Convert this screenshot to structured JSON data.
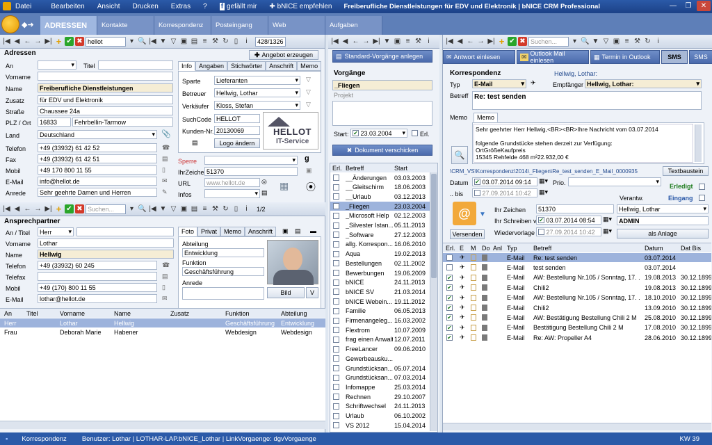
{
  "menu": {
    "items": [
      "Datei",
      "Bearbeiten",
      "Ansicht",
      "Drucken",
      "Extras",
      "?"
    ],
    "like": "gefällt mir",
    "bnice": "bNICE empfehlen",
    "title": "Freiberufliche Dienstleistungen für EDV und Elektronik | bNICE CRM  Professional"
  },
  "tabs": [
    "ADRESSEN",
    "Kontakte",
    "Korrespondenz",
    "Posteingang",
    "Web",
    "Aufgaben"
  ],
  "left_toolbar": {
    "search": "hellot",
    "count": "428/1326"
  },
  "address": {
    "section": "Adressen",
    "angebot_btn": "Angebot erzeugen",
    "labels": {
      "an": "An",
      "titel": "Titel",
      "vorname": "Vorname",
      "name": "Name",
      "zusatz": "Zusatz",
      "strasse": "Straße",
      "plz": "PLZ / Ort",
      "land": "Land",
      "telefon": "Telefon",
      "fax": "Fax",
      "mobil": "Mobil",
      "email": "E-Mail",
      "anrede": "Anrede"
    },
    "name": "Freiberufliche Dienstleistungen",
    "zusatz": "für EDV und Elektronik",
    "strasse": "Chaussee 24a",
    "plz": "16833",
    "ort": "Fehrbellin-Tarmow",
    "land": "Deutschland",
    "telefon": "+49 (33932)  61 42 52",
    "fax": "+49 (33932) 61 42 51",
    "mobil": "+49 170 800 11 55",
    "email": "info@hellot.de",
    "anrede": "Sehr geehrte Damen und Herren"
  },
  "info_tabs": [
    "Info",
    "Angaben",
    "Stichwörter",
    "Anschrift",
    "Memo"
  ],
  "info": {
    "sparte_l": "Sparte",
    "sparte": "Lieferanten",
    "betreuer_l": "Betreuer",
    "betreuer": "Hellwig, Lothar",
    "verkaeufer_l": "Verkäufer",
    "verkaeufer": "Kloss, Stefan",
    "suchcode_l": "SuchCode",
    "suchcode": "HELLOT",
    "kunden_l": "Kunden-Nr.",
    "kunden": "20130069",
    "logo_btn": "Logo ändern",
    "logo_line1": "HELLOT",
    "logo_line2": "IT-Service",
    "sperre_l": "Sperre",
    "ihrzeichen_l": "IhrZeichen",
    "ihrzeichen": "51370",
    "url_l": "URL",
    "url_ph": "www.hellot.de",
    "infos_l": "Infos"
  },
  "ap_toolbar": {
    "search": "Suchen...",
    "count": "1/2"
  },
  "ansprechpartner": {
    "section": "Ansprechpartner",
    "labels": {
      "an": "An / Titel",
      "vorname": "Vorname",
      "name": "Name",
      "telefon": "Telefon",
      "telefax": "Telefax",
      "mobil": "Mobil",
      "email": "E-Mail"
    },
    "an": "Herr",
    "vorname": "Lothar",
    "name": "Hellwig",
    "telefon": "+49 (33932) 60 245",
    "mobil": "+49 (170) 800 11 55",
    "email": "lothar@hellot.de"
  },
  "foto_tabs": [
    "Foto",
    "Privat",
    "Memo",
    "Anschrift"
  ],
  "foto": {
    "abteilung_l": "Abteilung",
    "abteilung": "Entwicklung",
    "funktion_l": "Funktion",
    "funktion": "Geschäftsführung",
    "anrede_l": "Anrede",
    "bild_btn": "Bild",
    "v_btn": "V"
  },
  "ap_table": {
    "headers": [
      "An",
      "Titel",
      "Vorname",
      "Name",
      "Zusatz",
      "Funktion",
      "Abteilung"
    ],
    "rows": [
      [
        "Herr",
        "",
        "Lothar",
        "Hellwig",
        "",
        "Geschäftsführung",
        "Entwicklung"
      ],
      [
        "Frau",
        "",
        "Deborah Marie",
        "Habener",
        "",
        "Webdesign",
        "Webdesign"
      ]
    ]
  },
  "vorgaenge": {
    "btn": "Standard-Vorgänge anlegen",
    "section": "Vorgänge",
    "current": "_Fliegen",
    "projekt_l": "Projekt",
    "start_l": "Start:",
    "start": "23.03.2004",
    "erl": "Erl.",
    "doc_btn": "Dokument verschicken",
    "headers": [
      "Erl.",
      "Betreff",
      "Start"
    ],
    "rows": [
      [
        "__Änderungen",
        "03.03.2003"
      ],
      [
        "__Gleitschirm",
        "18.06.2003"
      ],
      [
        "__Urlaub",
        "03.12.2013"
      ],
      [
        "_Fliegen",
        "23.03.2004"
      ],
      [
        "_Microsoft Help",
        "02.12.2003"
      ],
      [
        "_Silvester Istan...",
        "05.11.2013"
      ],
      [
        "_Software",
        "27.12.2003"
      ],
      [
        "allg. Korrespon...",
        "16.06.2010"
      ],
      [
        "Aqua",
        "19.02.2013"
      ],
      [
        "Bestellungen",
        "02.11.2002"
      ],
      [
        "Bewerbungen",
        "19.06.2009"
      ],
      [
        "bNICE",
        "24.11.2013"
      ],
      [
        "bNICE SV",
        "21.03.2014"
      ],
      [
        "bNICE Webein...",
        "19.11.2012"
      ],
      [
        "Familie",
        "06.05.2013"
      ],
      [
        "Firmenangeleg...",
        "16.03.2002"
      ],
      [
        "Flextrom",
        "10.07.2009"
      ],
      [
        "frag einen Anwalt",
        "12.07.2011"
      ],
      [
        "FreeLancer",
        "09.06.2010"
      ],
      [
        "Gewerbeausku...",
        ""
      ],
      [
        "Grundstücksan...",
        "05.07.2014"
      ],
      [
        "Grundstücksan...",
        "07.03.2014"
      ],
      [
        "Infomappe",
        "25.03.2014"
      ],
      [
        "Rechnen",
        "29.10.2007"
      ],
      [
        "Schriftwechsel",
        "24.11.2013"
      ],
      [
        "Urlaub",
        "06.10.2002"
      ],
      [
        "VS 2012",
        "15.04.2014"
      ]
    ]
  },
  "korr": {
    "btn_antwort": "Antwort einlesen",
    "btn_outlook": "Outlook Mail einlesen",
    "btn_termin": "Termin in Outlook",
    "btn_sms": "SMS",
    "btn_sms2": "SMS",
    "section": "Korrespondenz",
    "contact": "Hellwig, Lothar:",
    "typ_l": "Typ",
    "typ": "E-Mail",
    "empf_l": "Empfänger",
    "empf": "Hellwig, Lothar:",
    "betreff_l": "Betreff",
    "betreff": "Re: test senden",
    "memo_l": "Memo",
    "memo_tab": "Memo",
    "memo_lines": [
      "Sehr geehrter Herr Hellwig,<BR><BR>Ihre Nachricht vom 03.07.2014",
      "",
      "folgende Grundstücke stehen derzeit zur Verfügung:",
      "OrtGrößeKaufpreis",
      "15345 Rehfelde 468 m²22.932,00 €"
    ],
    "path": "\\CRM_VS\\Korrespondenz\\2014\\_Fliegen\\Re_test_senden_E_Mail_00009356.bml",
    "textbaustein": "Textbaustein",
    "datum_l": "Datum",
    "datum": "03.07.2014 09:14",
    "bis_l": ".. bis",
    "bis": "27.09.2014 10:42",
    "prio_l": "Prio.",
    "erledigt": "Erledigt",
    "verantw_l": "Verantw.",
    "eingang": "Eingang",
    "versenden": "Versenden",
    "ihrzeichen_l": "Ihr Zeichen",
    "ihrzeichen": "51370",
    "ihrschreiben_l": "Ihr Schreiben v.",
    "ihrschreiben": "03.07.2014 08:54",
    "wiedervorlage_l": "Wiedervorlage",
    "wiedervorlage": "27.09.2014 10:42",
    "verantw": "Hellwig, Lothar",
    "admin": "ADMIN",
    "anlage": "als Anlage",
    "headers": [
      "Erl.",
      "E",
      "M",
      "Do",
      "Anl",
      "Typ",
      "Betreff",
      "Datum",
      "Dat Bis"
    ],
    "rows": [
      [
        "E-Mail",
        "Re: test senden",
        "03.07.2014",
        ""
      ],
      [
        "E-Mail",
        "test senden",
        "03.07.2014",
        ""
      ],
      [
        "E-Mail",
        "AW: Bestellung Nr.105 / Sonntag, 17. ...",
        "19.08.2013",
        "30.12.1899"
      ],
      [
        "E-Mail",
        "Chili2",
        "19.08.2013",
        "30.12.1899"
      ],
      [
        "E-Mail",
        "AW: Bestellung Nr.105 / Sonntag, 17. ...",
        "18.10.2010",
        "30.12.1899"
      ],
      [
        "E-Mail",
        "Chili2",
        "13.09.2010",
        "30.12.1899"
      ],
      [
        "E-Mail",
        "AW: Bestätigung Bestellung Chili 2 M",
        "25.08.2010",
        "30.12.1899"
      ],
      [
        "E-Mail",
        "Bestätigung Bestellung Chili 2 M",
        "17.08.2010",
        "30.12.1899"
      ],
      [
        "E-Mail",
        "Re: AW: Propeller A4",
        "28.06.2010",
        "30.12.1899"
      ]
    ]
  },
  "status": {
    "module": "Korrespondenz",
    "info": "Benutzer:  Lothar  |  LOTHAR-LAP.bNICE_Lothar  |  LinkVorgaenge: dgvVorgaenge",
    "kw": "KW 39"
  },
  "colors": {
    "menubar": "#2b5aa8",
    "tabs": "#5e7fb8",
    "selected_row": "#9db3dc",
    "highlight_field": "#f5edd5"
  }
}
